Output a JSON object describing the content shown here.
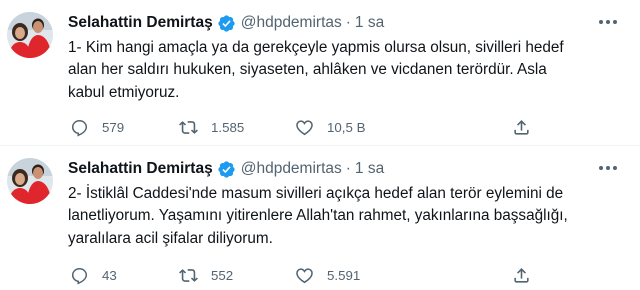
{
  "tweets": [
    {
      "author_name": "Selahattin Demirtaş",
      "handle": "@hdpdemirtas",
      "separator": "·",
      "time": "1 sa",
      "text": "1- Kim hangi amaçla ya da gerekçeyle yapmis olursa olsun, sivilleri hedef\nalan her saldırı hukuken, siyaseten, ahlâken ve vicdanen terördür. Asla\nkabul etmiyoruz.",
      "replies": "579",
      "retweets": "1.585",
      "likes": "10,5 B"
    },
    {
      "author_name": "Selahattin Demirtaş",
      "handle": "@hdpdemirtas",
      "separator": "·",
      "time": "1 sa",
      "text": "2- İstiklâl Caddesi'nde masum sivilleri açıkça hedef alan terör eylemini de\nlanetliyorum. Yaşamını yitirenlere Allah'tan rahmet, yakınlarına başsağlığı,\nyaralılara acil şifalar diliyorum.",
      "replies": "43",
      "retweets": "552",
      "likes": "5.591"
    }
  ],
  "colors": {
    "text_primary": "#0f1419",
    "text_secondary": "#536471",
    "verified_blue": "#1d9bf0",
    "divider": "#eff3f4",
    "avatar_red": "#e0262d"
  },
  "icons": [
    "verified-badge-icon",
    "more-dots-icon",
    "reply-icon",
    "retweet-icon",
    "like-icon",
    "share-icon"
  ]
}
